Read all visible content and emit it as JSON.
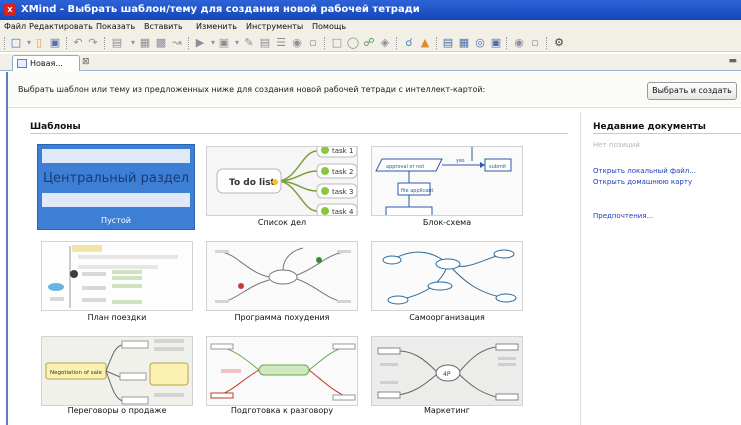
{
  "window": {
    "app_badge": "X",
    "title": "XMind - Выбрать шаблон/тему для создания новой рабочей тетради"
  },
  "menu": [
    "Файл",
    "Редактировать",
    "Показать",
    "Вставить",
    "Изменить",
    "Инструменты",
    "Помощь"
  ],
  "toolbar_icons": [
    "new-workbook-icon",
    "open-folder-icon",
    "save-icon",
    "undo-icon",
    "redo-icon",
    "topic-icon",
    "subtopic-icon",
    "floating-topic-icon",
    "relationship-icon",
    "boundary-icon",
    "summary-icon",
    "marker-icon",
    "image-icon",
    "label-icon",
    "note-icon",
    "link-icon",
    "attachment-icon",
    "pin-icon",
    "presentation-icon",
    "share-icon",
    "chart-view-icon",
    "outline-view-icon",
    "fit-view-icon",
    "layout-icon",
    "zoom-icon",
    "settings-gear-icon"
  ],
  "editor_tab": {
    "label": "Новая..."
  },
  "instruction": {
    "text": "Выбрать шаблон или тему из предложенных ниже для создания новой рабочей тетради с интеллект-картой:",
    "button_label": "Выбрать и создать"
  },
  "templates": {
    "heading": "Шаблоны",
    "empty_preview_text": "Центральный раздел",
    "items": [
      {
        "label": "Пустой",
        "selected": true
      },
      {
        "label": "Список дел"
      },
      {
        "label": "Блок-схема"
      },
      {
        "label": "План поездки"
      },
      {
        "label": "Программа похудения"
      },
      {
        "label": "Самоорганизация"
      },
      {
        "label": "Переговоры о продаже"
      },
      {
        "label": "Подготовка к разговору"
      },
      {
        "label": "Маркетинг"
      }
    ],
    "todo_preview": {
      "center": "To do list",
      "tasks": [
        "task 1",
        "task 2",
        "task 3",
        "task 4"
      ]
    },
    "flow_preview": {
      "nodes": [
        "approval or not",
        "submit",
        "file applicant"
      ],
      "edge_label": "yes"
    },
    "sales_preview": {
      "center": "Negotiation of sale"
    },
    "marketing_preview": {
      "center": "4P"
    }
  },
  "recent": {
    "heading": "Недавние документы",
    "empty_text": "Нет позиций",
    "open_local": "Открыть локальный файл...",
    "open_home": "Открыть домашнюю карту",
    "preferences": "Предпочтения..."
  },
  "colors": {
    "titlebar": "#1e52c8",
    "selection": "#3d7fd4",
    "link": "#1d3fb8",
    "todo_green": "#8cc63f",
    "map_blue": "#2b5aa8"
  }
}
